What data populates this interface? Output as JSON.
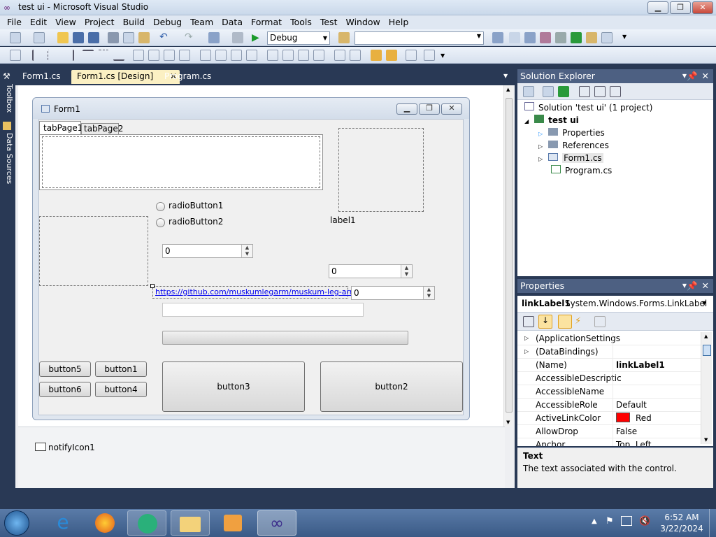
{
  "window": {
    "title": "test ui - Microsoft Visual Studio"
  },
  "menu": [
    "File",
    "Edit",
    "View",
    "Project",
    "Build",
    "Debug",
    "Team",
    "Data",
    "Format",
    "Tools",
    "Test",
    "Window",
    "Help"
  ],
  "toolbar": {
    "config": "Debug",
    "platform": ""
  },
  "left_tabs": [
    "Toolbox",
    "Data Sources"
  ],
  "doc_tabs": [
    "Form1.cs",
    "Form1.cs [Design]",
    "Program.cs"
  ],
  "form": {
    "title": "Form1",
    "tabs": [
      "tabPage1",
      "tabPage2"
    ],
    "radio1": "radioButton1",
    "radio2": "radioButton2",
    "label1": "label1",
    "num1": "0",
    "num2": "0",
    "num3": "0",
    "link": "https://github.com/muskumlegarm/muskum-leg-arm/wiki",
    "buttons": {
      "b5": "button5",
      "b1": "button1",
      "b6": "button6",
      "b4": "button4",
      "b3": "button3",
      "b2": "button2"
    }
  },
  "tray": {
    "item": "notifyIcon1"
  },
  "solution_explorer": {
    "header": "Solution Explorer",
    "solution": "Solution 'test ui' (1 project)",
    "project": "test ui",
    "items": [
      "Properties",
      "References",
      "Form1.cs",
      "Program.cs"
    ]
  },
  "properties": {
    "header": "Properties",
    "object": "linkLabel1",
    "object_type": "System.Windows.Forms.LinkLabel",
    "rows": [
      {
        "k": "(ApplicationSettings",
        "v": ""
      },
      {
        "k": "(DataBindings)",
        "v": ""
      },
      {
        "k": "(Name)",
        "v": "linkLabel1"
      },
      {
        "k": "AccessibleDescriptic",
        "v": ""
      },
      {
        "k": "AccessibleName",
        "v": ""
      },
      {
        "k": "AccessibleRole",
        "v": "Default"
      },
      {
        "k": "ActiveLinkColor",
        "v": "Red"
      },
      {
        "k": "AllowDrop",
        "v": "False"
      },
      {
        "k": "Anchor",
        "v": "Top, Left"
      }
    ],
    "desc_title": "Text",
    "desc_text": "The text associated with the control."
  },
  "clock": {
    "time": "6:52 AM",
    "date": "3/22/2024"
  },
  "colors": {
    "accent": "#293955",
    "active_tab": "#fbf0c3",
    "red_swatch": "#ff0000"
  }
}
